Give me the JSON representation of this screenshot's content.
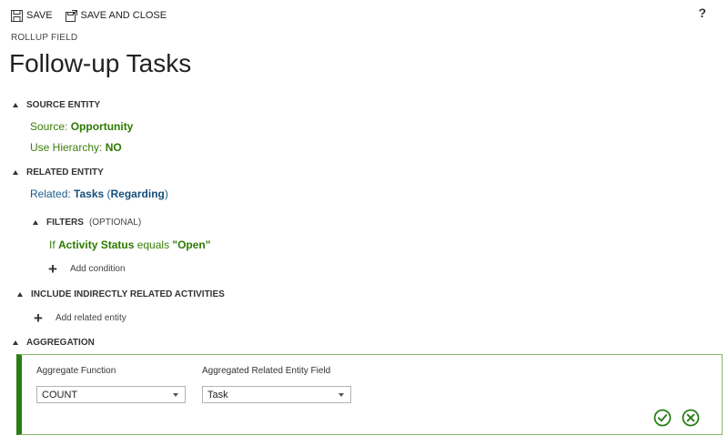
{
  "toolbar": {
    "save_label": "SAVE",
    "save_close_label": "SAVE AND CLOSE",
    "help_label": "?"
  },
  "header": {
    "field_type": "ROLLUP FIELD",
    "title": "Follow-up Tasks"
  },
  "source_entity": {
    "heading": "SOURCE ENTITY",
    "source_label": "Source: ",
    "source_value": "Opportunity",
    "hierarchy_label": "Use Hierarchy: ",
    "hierarchy_value": "NO"
  },
  "related_entity": {
    "heading": "RELATED ENTITY",
    "related_label": "Related: ",
    "related_value": "Tasks",
    "related_open": " (",
    "related_rel": "Regarding",
    "related_close": ")"
  },
  "filters": {
    "heading": "FILTERS",
    "optional": "(OPTIONAL)",
    "cond_if": "If ",
    "cond_field": "Activity Status",
    "cond_op": " equals ",
    "cond_value": "\"Open\"",
    "add_condition": "Add condition"
  },
  "indirect": {
    "heading": "INCLUDE INDIRECTLY RELATED ACTIVITIES",
    "add_entity": "Add related entity"
  },
  "aggregation": {
    "heading": "AGGREGATION",
    "function_label": "Aggregate Function",
    "function_value": "COUNT",
    "field_label": "Aggregated Related Entity Field",
    "field_value": "Task"
  },
  "colors": {
    "accent_green": "#2a7d17",
    "link_green": "#3a7d0a",
    "link_blue": "#1a5c8a"
  }
}
